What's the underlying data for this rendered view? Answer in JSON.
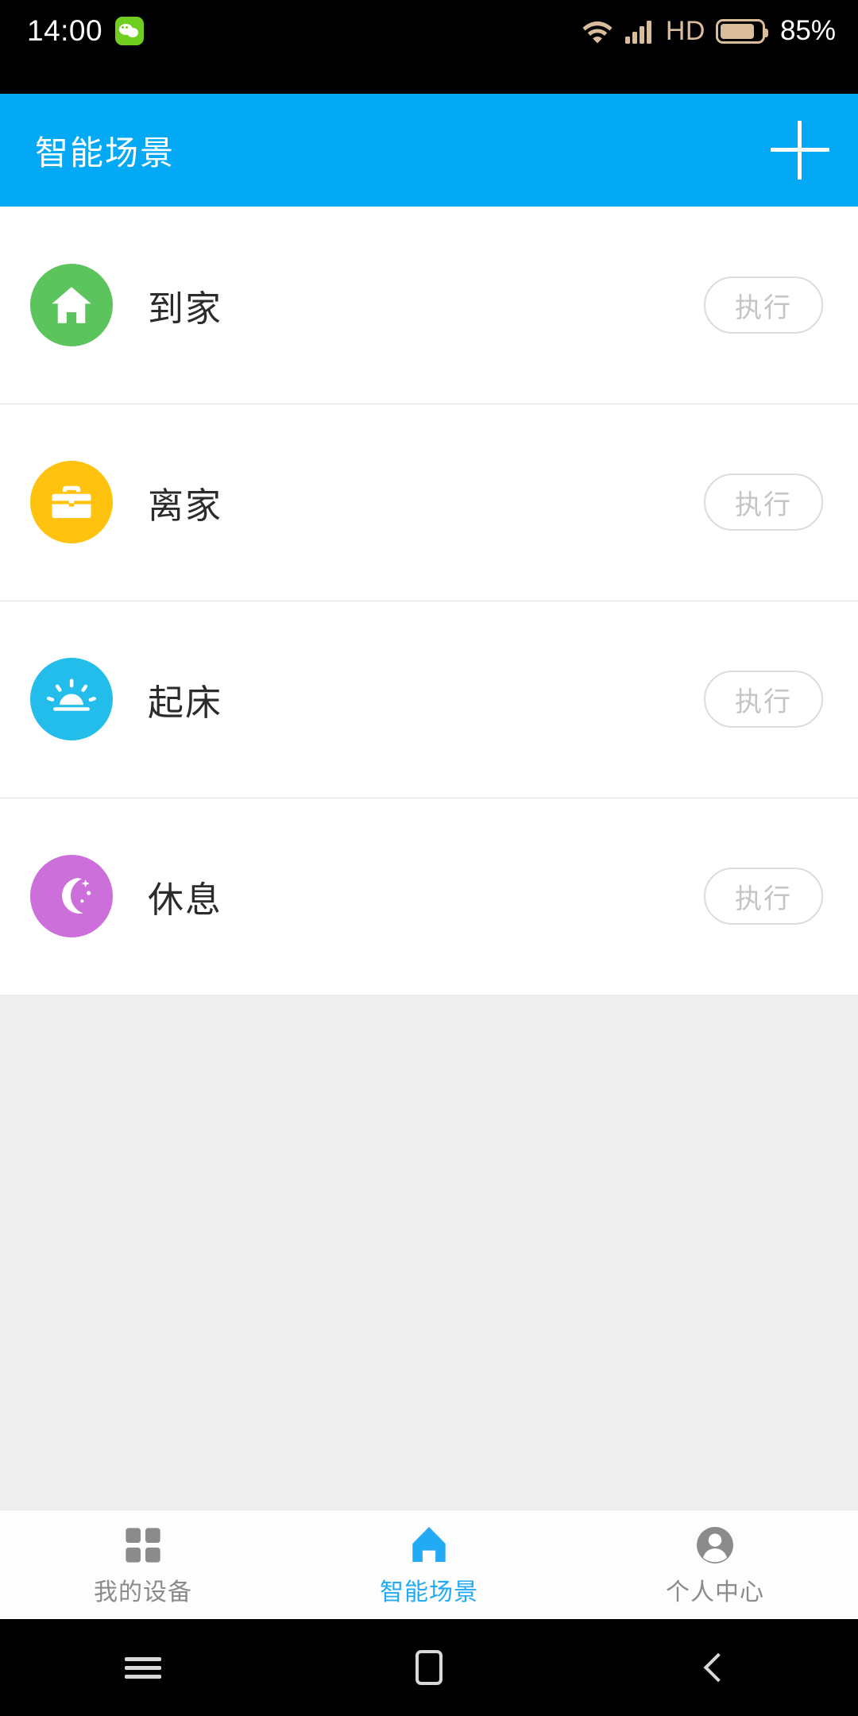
{
  "status_bar": {
    "time": "14:00",
    "notification_icon": "wechat-icon",
    "icons": [
      "wifi-icon",
      "cellular-signal-icon"
    ],
    "network_label": "HD",
    "battery_icon": "battery-icon",
    "battery_percent": "85%",
    "battery_level": 85,
    "text_color": "#ffffff",
    "icon_color": "#d8bc9c"
  },
  "header": {
    "title": "智能场景",
    "add_icon": "plus-icon",
    "background_color": "#03a9f4",
    "text_color": "#ffffff"
  },
  "scenes": [
    {
      "label": "到家",
      "icon": "home-icon",
      "icon_color": "#5cc45c",
      "action_label": "执行"
    },
    {
      "label": "离家",
      "icon": "briefcase-icon",
      "icon_color": "#ffc20e",
      "action_label": "执行"
    },
    {
      "label": "起床",
      "icon": "sunrise-icon",
      "icon_color": "#22bdea",
      "action_label": "执行"
    },
    {
      "label": "休息",
      "icon": "moon-stars-icon",
      "icon_color": "#cc6fdb",
      "action_label": "执行"
    }
  ],
  "tabbar": {
    "active_color": "#22aaf5",
    "inactive_color": "#8b8b8b",
    "items": [
      {
        "label": "我的设备",
        "icon": "grid-icon",
        "active": false
      },
      {
        "label": "智能场景",
        "icon": "home-icon",
        "active": true
      },
      {
        "label": "个人中心",
        "icon": "person-icon",
        "active": false
      }
    ]
  },
  "system_nav": {
    "recents_icon": "menu-icon",
    "home_icon": "square-icon",
    "back_icon": "chevron-left-icon"
  }
}
